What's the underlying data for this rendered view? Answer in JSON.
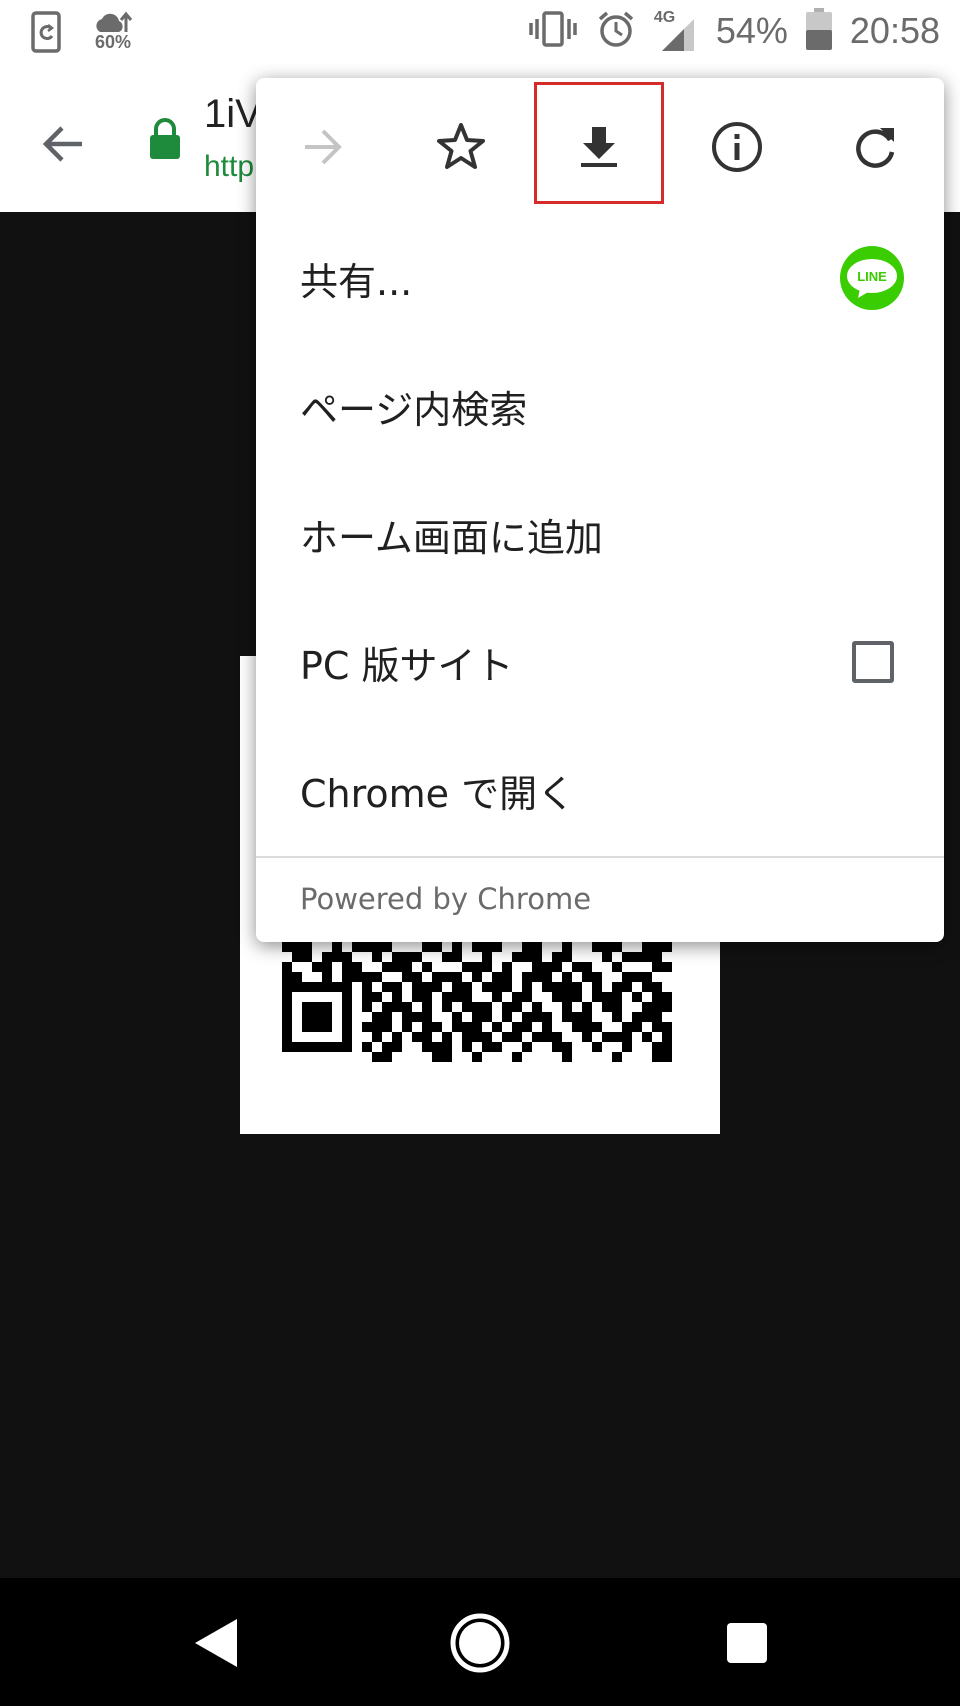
{
  "status_bar": {
    "weather_percent": "60%",
    "network": "4G",
    "battery": "54%",
    "time": "20:58"
  },
  "toolbar": {
    "title_partial": "1iV",
    "url_partial": "http"
  },
  "menu": {
    "items": [
      {
        "label": "共有..."
      },
      {
        "label": "ページ内検索"
      },
      {
        "label": "ホーム画面に追加"
      },
      {
        "label": "PC 版サイト"
      },
      {
        "label": "Chrome で開く"
      }
    ],
    "line_badge": "LINE",
    "footer": "Powered by Chrome",
    "highlight_color": "#d52b2b"
  },
  "icons": [
    "forward-icon",
    "star-icon",
    "download-icon",
    "info-icon",
    "reload-icon",
    "line-icon",
    "back-icon",
    "lock-icon",
    "nav-back-icon",
    "nav-home-icon",
    "nav-recents-icon"
  ]
}
